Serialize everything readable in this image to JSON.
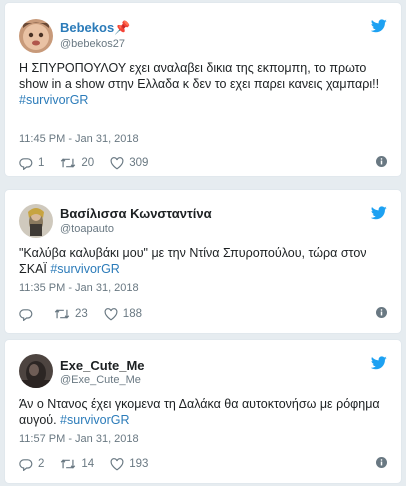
{
  "tweets": [
    {
      "name": "Bebekos",
      "name_emoji": "📌",
      "handle": "@bebekos27",
      "text": "Η ΣΠΥΡΟΠΟΥΛΟΥ εχει αναλαβει δικια της εκπομπη, το πρωτο show in a show στην Ελλαδα κ δεν το εχει παρει κανεις χαμπαρι!! ",
      "hashtag": "#survivorGR",
      "time": "11:45 PM - Jan 31, 2018",
      "replies": "1",
      "retweets": "20",
      "likes": "309"
    },
    {
      "name": "Βασίλισσα Κωνσταντίνα",
      "handle": "@toapauto",
      "text": "\"Καλύβα καλυβάκι μου\" με την Ντίνα Σπυροπούλου, τώρα στον ΣΚΑΪ ",
      "hashtag": "#survivorGR",
      "time": "11:35 PM - Jan 31, 2018",
      "replies": "",
      "retweets": "23",
      "likes": "188"
    },
    {
      "name": "Exe_Cute_Me",
      "handle": "@Exe_Cute_Me",
      "text": "Άν ο Ντανος έχει γκομενα τη Δαλάκα θα αυτοκτονήσω με ρόφημα αυγού. ",
      "hashtag": "#survivorGR",
      "time": "11:57 PM - Jan 31, 2018",
      "replies": "2",
      "retweets": "14",
      "likes": "193"
    }
  ],
  "colors": {
    "twitter_blue": "#1da1f2",
    "link": "#2b7bb9",
    "muted": "#697882",
    "background": "#e6ecf0"
  },
  "icons": [
    "twitter-bird-icon",
    "reply-icon",
    "retweet-icon",
    "heart-icon",
    "info-icon"
  ]
}
